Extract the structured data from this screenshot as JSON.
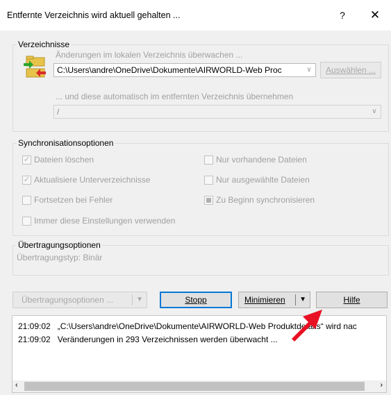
{
  "window": {
    "title": "Entfernte Verzeichnis wird aktuell gehalten ...",
    "help_label": "?",
    "close_label": "✕"
  },
  "directories": {
    "group_label": "Verzeichnisse",
    "local_caption": "Änderungen im lokalen Verzeichnis überwachen ...",
    "local_path": "C:\\Users\\andre\\OneDrive\\Dokumente\\AIRWORLD-Web Proc",
    "browse_label": "Auswählen ...",
    "remote_caption": "... und diese automatisch im entfernten Verzeichnis übernehmen",
    "remote_path": "/"
  },
  "sync": {
    "group_label": "Synchronisationsoptionen",
    "options": [
      {
        "label": "Dateien löschen",
        "checked": true
      },
      {
        "label": "Nur vorhandene Dateien",
        "checked": false
      },
      {
        "label": "Aktualisiere Unterverzeichnisse",
        "checked": true
      },
      {
        "label": "Nur ausgewählte Dateien",
        "checked": false
      },
      {
        "label": "Fortsetzen bei Fehler",
        "checked": false
      },
      {
        "label": "Zu Beginn synchronisieren",
        "checked": "indeterminate"
      },
      {
        "label": "Immer diese Einstellungen verwenden",
        "checked": false
      }
    ]
  },
  "transfer": {
    "group_label": "Übertragungsoptionen",
    "type_text": "Übertragungstyp: Binär"
  },
  "buttons": {
    "transfer_options": "Übertragungsoptionen ...",
    "stop": "Stopp",
    "minimize": "Minimieren",
    "help": "Hilfe"
  },
  "log": [
    {
      "time": "21:09:02",
      "text": "„C:\\Users\\andre\\OneDrive\\Dokumente\\AIRWORLD-Web Produktdetails“ wird nac"
    },
    {
      "time": "21:09:02",
      "text": "Veränderungen in 293 Verzeichnissen werden überwacht ..."
    }
  ],
  "colors": {
    "accent": "#0078d7",
    "annotation_arrow": "#e81123"
  }
}
